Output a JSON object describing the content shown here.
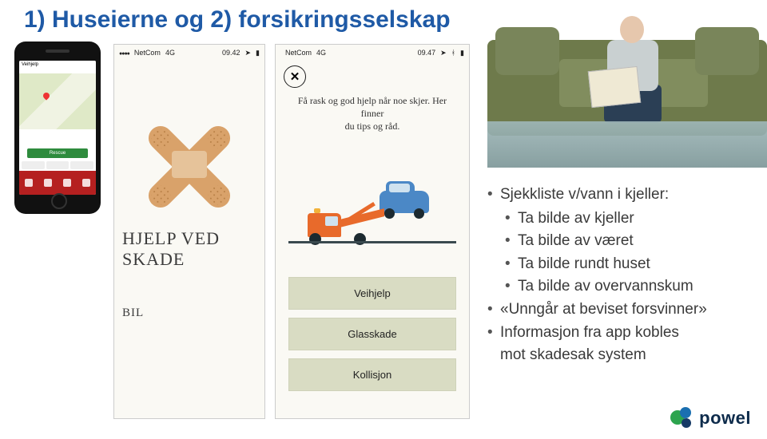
{
  "title": "1) Huseierne og 2) forsikringsselskap",
  "phone": {
    "header": "Veihjelp",
    "rescue_label": "Rescue"
  },
  "app2": {
    "carrier": "NetCom",
    "network": "4G",
    "time": "09.42",
    "heading": "Hjelp ved skade",
    "category": "Bil"
  },
  "app3": {
    "carrier": "NetCom",
    "network": "4G",
    "time": "09.47",
    "close_label": "✕",
    "desc_line1": "Få rask og god hjelp når noe skjer. Her finner",
    "desc_line2": "du tips og råd.",
    "items": [
      "Veihjelp",
      "Glasskade",
      "Kollisjon"
    ]
  },
  "bullets": {
    "heading": "Sjekkliste v/vann i kjeller:",
    "subs": [
      "Ta bilde av kjeller",
      "Ta bilde av været",
      "Ta bilde rundt huset",
      "Ta bilde av overvannskum"
    ],
    "line2": "«Unngår at beviset forsvinner»",
    "line3a": "Informasjon fra app kobles",
    "line3b": "mot skadesak system"
  },
  "logo": {
    "word": "powel"
  }
}
